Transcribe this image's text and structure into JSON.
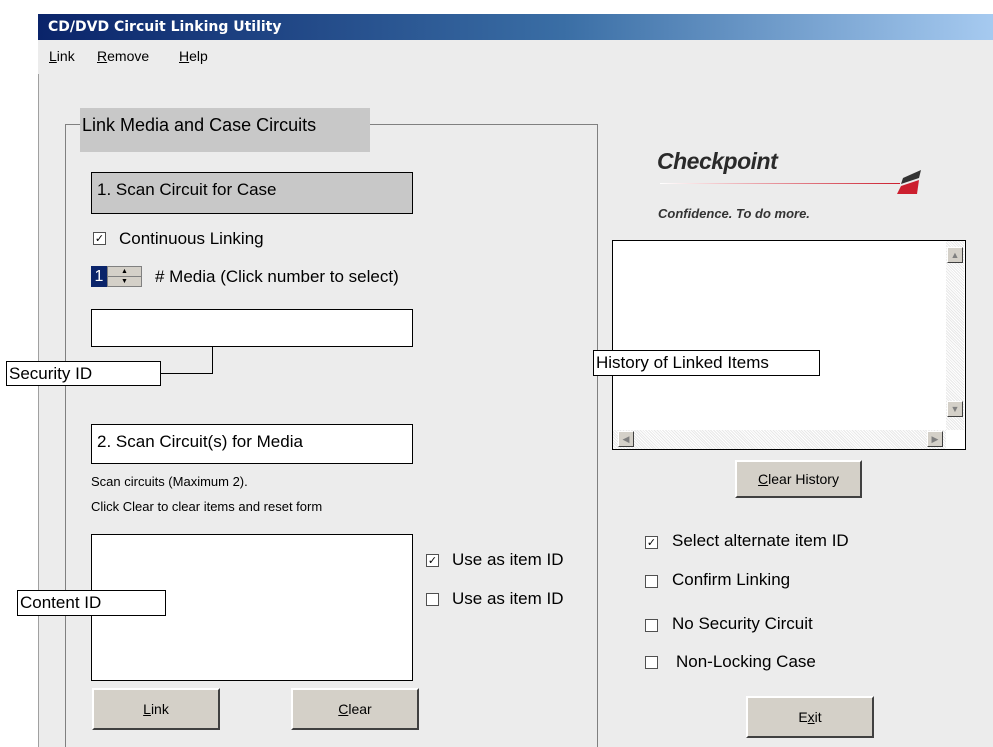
{
  "window": {
    "title": "CD/DVD Circuit Linking Utility"
  },
  "menu": [
    {
      "label": "Link",
      "accel": "L",
      "rest": "ink"
    },
    {
      "label": "Remove",
      "accel": "R",
      "rest": "emove"
    },
    {
      "label": "Help",
      "accel": "H",
      "rest": "elp"
    }
  ],
  "group": {
    "title": "Link Media and Case Circuits"
  },
  "step1": {
    "label": "1. Scan Circuit for Case"
  },
  "continuous": {
    "label": "Continuous Linking",
    "checked": true
  },
  "media": {
    "value": "1",
    "label": "# Media (Click number to select)"
  },
  "callouts": {
    "security": "Security ID",
    "history": "History of Linked Items",
    "content": "Content ID"
  },
  "step2": {
    "label": "2. Scan Circuit(s) for Media"
  },
  "instructions": {
    "line1": "Scan circuits (Maximum 2).",
    "line2": "Click Clear to clear items and reset form"
  },
  "item_id_options": [
    {
      "label": "Use as item ID",
      "checked": true
    },
    {
      "label": "Use as item ID",
      "checked": false
    }
  ],
  "buttons": {
    "link": {
      "accel": "L",
      "rest": "ink"
    },
    "clear": {
      "accel": "C",
      "rest": "lear"
    },
    "clear_history": {
      "accel": "C",
      "rest": "lear History"
    },
    "exit": {
      "pre": "E",
      "accel": "x",
      "rest": "it"
    }
  },
  "brand": {
    "name": "Checkpoint",
    "tagline": "Confidence. To do more.",
    "color": "#cc1f2f"
  },
  "options": [
    {
      "label": "Select alternate item ID",
      "checked": true
    },
    {
      "label": "Confirm Linking",
      "checked": false
    },
    {
      "label": "No Security Circuit",
      "checked": false
    },
    {
      "label": "Non-Locking Case",
      "checked": false
    }
  ],
  "icons": {
    "check": "✓"
  }
}
